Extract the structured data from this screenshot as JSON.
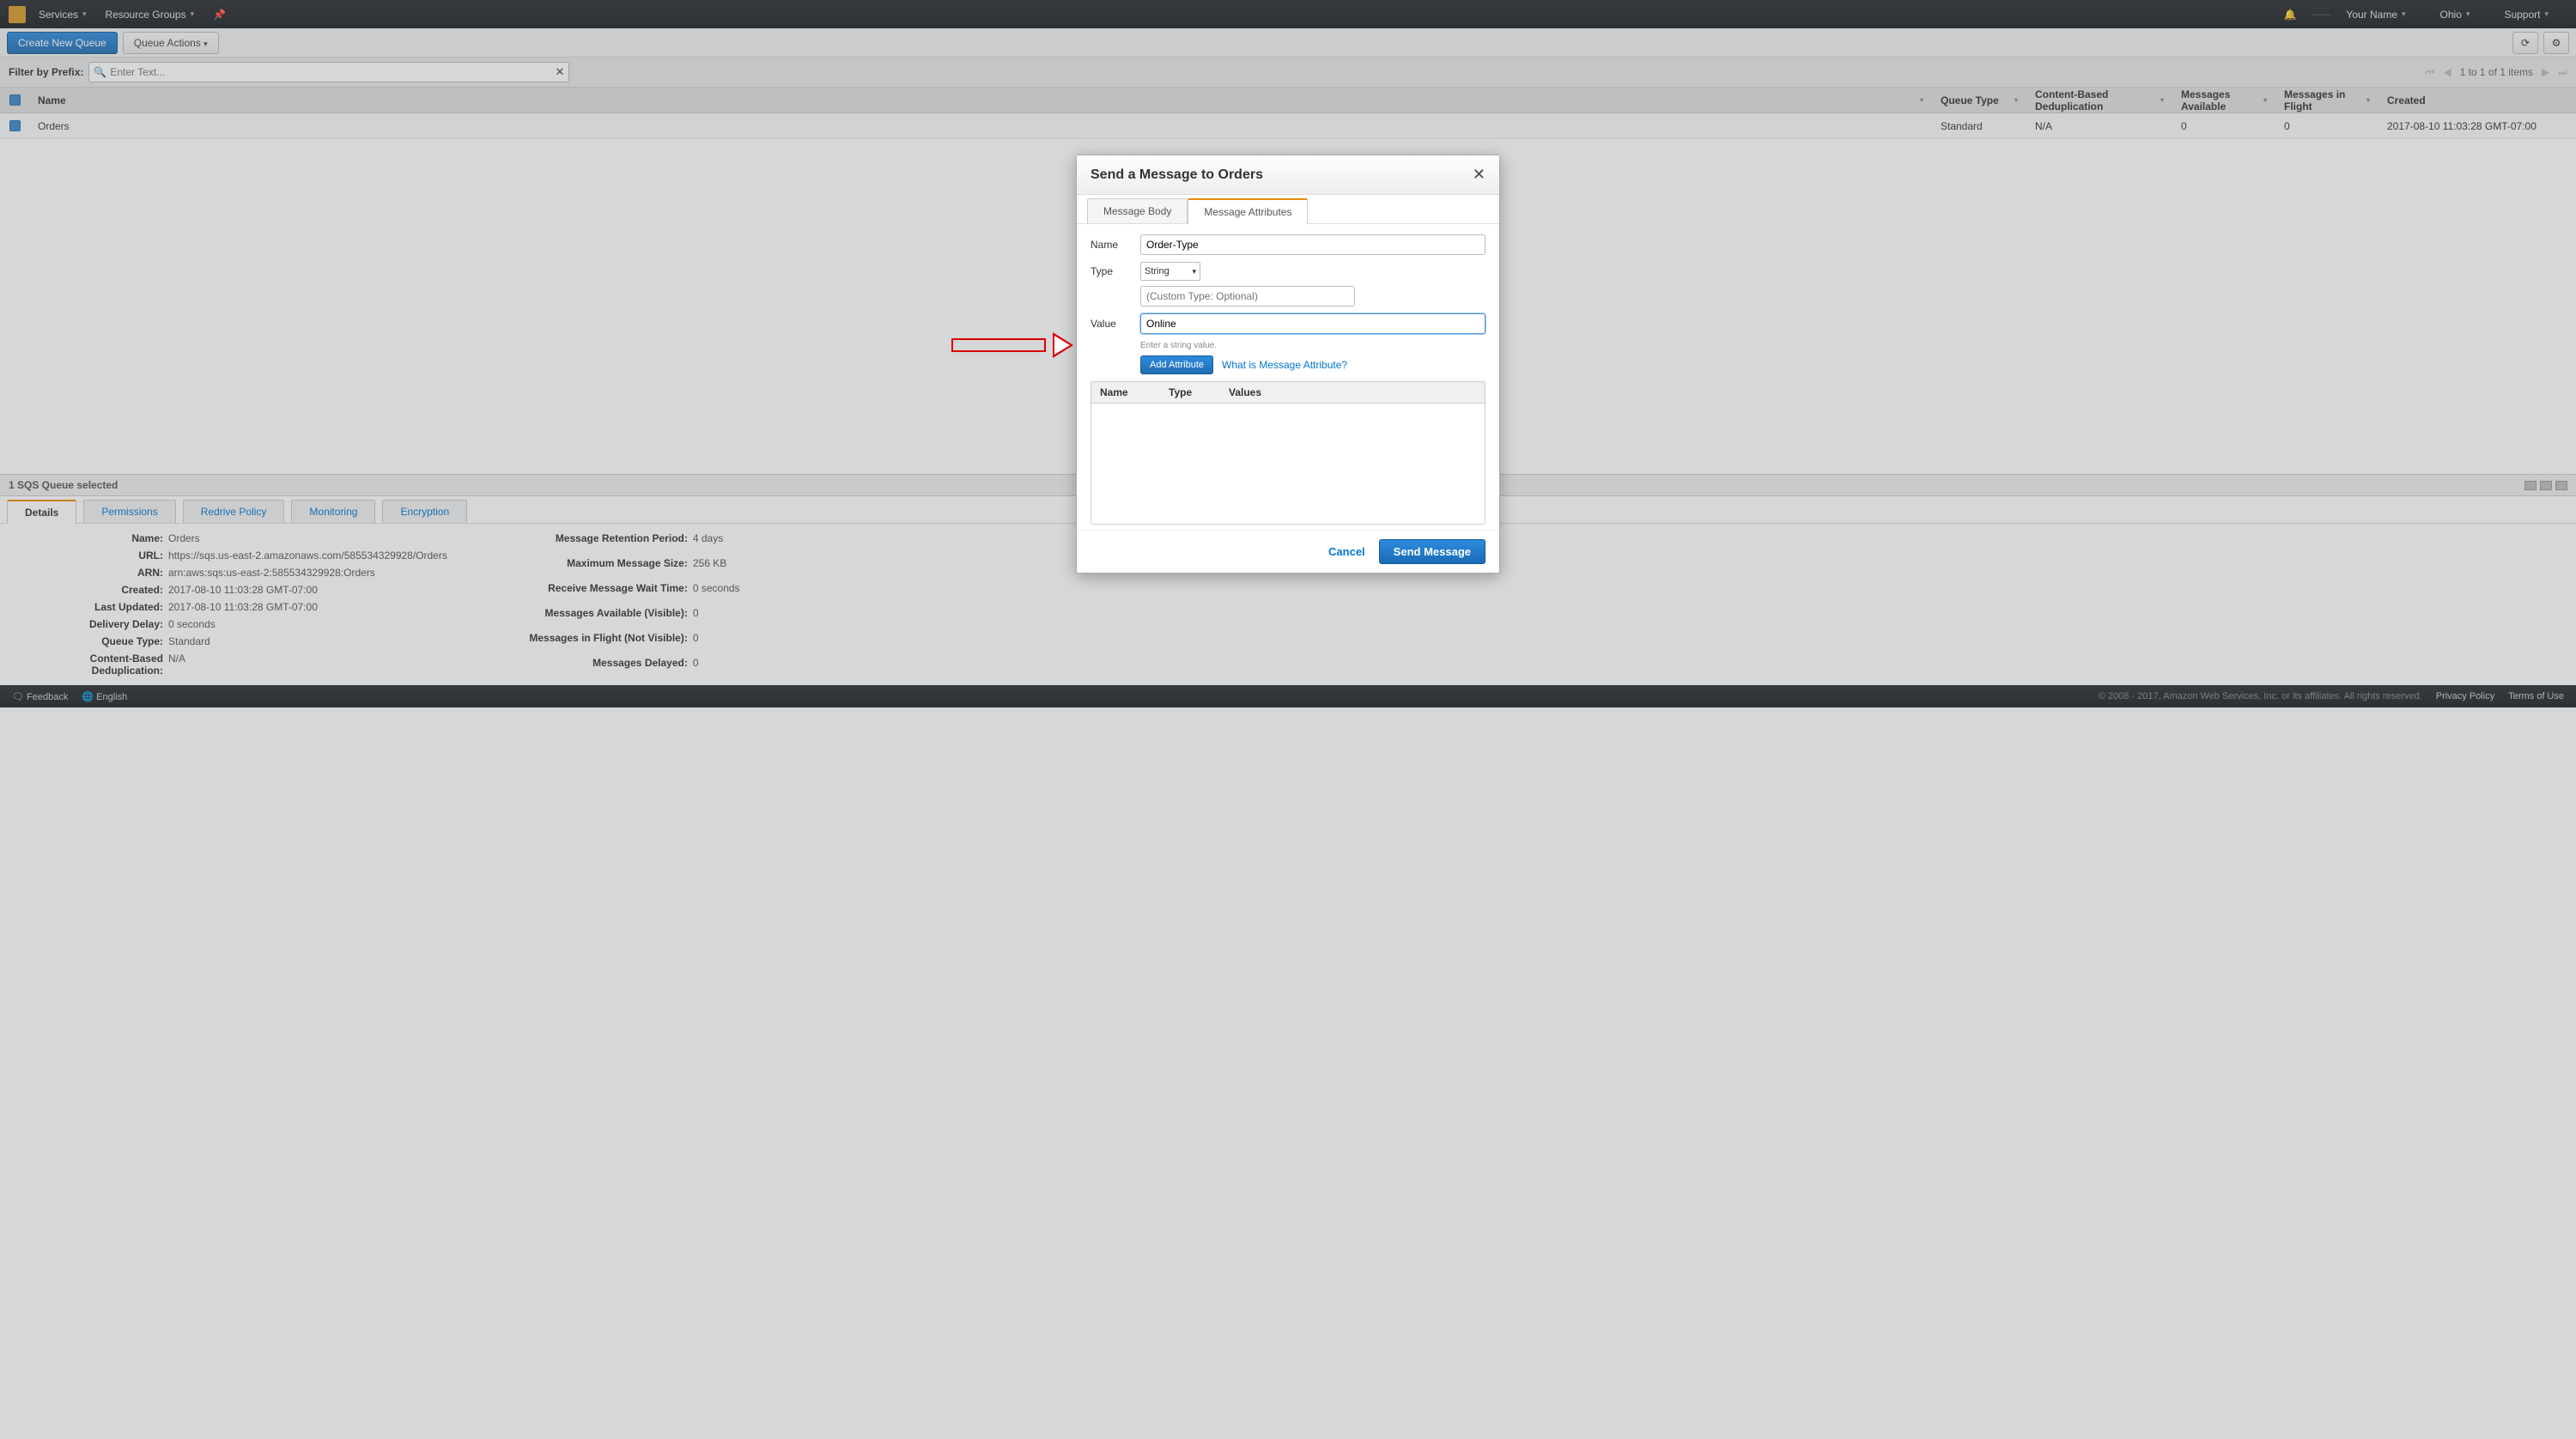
{
  "topnav": {
    "services": "Services",
    "resource_groups": "Resource Groups",
    "your_name": "Your Name",
    "region": "Ohio",
    "support": "Support"
  },
  "toolbar": {
    "create_queue": "Create New Queue",
    "queue_actions": "Queue Actions"
  },
  "filter": {
    "label": "Filter by Prefix:",
    "placeholder": "Enter Text...",
    "pager_text": "1 to 1 of 1 items"
  },
  "table": {
    "headers": {
      "name": "Name",
      "queue_type": "Queue Type",
      "dedup": "Content-Based Deduplication",
      "avail": "Messages Available",
      "flight": "Messages in Flight",
      "created": "Created"
    },
    "row": {
      "name": "Orders",
      "queue_type": "Standard",
      "dedup": "N/A",
      "avail": "0",
      "flight": "0",
      "created": "2017-08-10 11:03:28 GMT-07:00"
    }
  },
  "status": {
    "text": "1 SQS Queue selected"
  },
  "detail_tabs": {
    "details": "Details",
    "permissions": "Permissions",
    "redrive": "Redrive Policy",
    "monitoring": "Monitoring",
    "encryption": "Encryption"
  },
  "details_left": {
    "name_k": "Name:",
    "name_v": "Orders",
    "url_k": "URL:",
    "url_v": "https://sqs.us-east-2.amazonaws.com/585534329928/Orders",
    "arn_k": "ARN:",
    "arn_v": "arn:aws:sqs:us-east-2:585534329928:Orders",
    "created_k": "Created:",
    "created_v": "2017-08-10 11:03:28 GMT-07:00",
    "updated_k": "Last Updated:",
    "updated_v": "2017-08-10 11:03:28 GMT-07:00",
    "delay_k": "Delivery Delay:",
    "delay_v": "0 seconds",
    "qtype_k": "Queue Type:",
    "qtype_v": "Standard",
    "dedup_k": "Content-Based Deduplication:",
    "dedup_v": "N/A"
  },
  "details_right": {
    "ret_k": "Message Retention Period:",
    "ret_v": "4 days",
    "max_k": "Maximum Message Size:",
    "max_v": "256 KB",
    "wait_k": "Receive Message Wait Time:",
    "wait_v": "0 seconds",
    "avail_k": "Messages Available (Visible):",
    "avail_v": "0",
    "flight_k": "Messages in Flight (Not Visible):",
    "flight_v": "0",
    "delayed_k": "Messages Delayed:",
    "delayed_v": "0"
  },
  "footer": {
    "feedback": "Feedback",
    "english": "English",
    "copyright": "© 2008 - 2017, Amazon Web Services, Inc. or its affiliates. All rights reserved.",
    "privacy": "Privacy Policy",
    "terms": "Terms of Use"
  },
  "modal": {
    "title": "Send a Message to Orders",
    "tab_body": "Message Body",
    "tab_attrs": "Message Attributes",
    "name_label": "Name",
    "name_value": "Order-Type",
    "type_label": "Type",
    "type_value": "String",
    "custom_placeholder": "(Custom Type: Optional)",
    "value_label": "Value",
    "value_value": "Online",
    "hint": "Enter a string value.",
    "add_attr": "Add Attribute",
    "help_link": "What is Message Attribute?",
    "col_name": "Name",
    "col_type": "Type",
    "col_values": "Values",
    "cancel": "Cancel",
    "send": "Send Message"
  }
}
